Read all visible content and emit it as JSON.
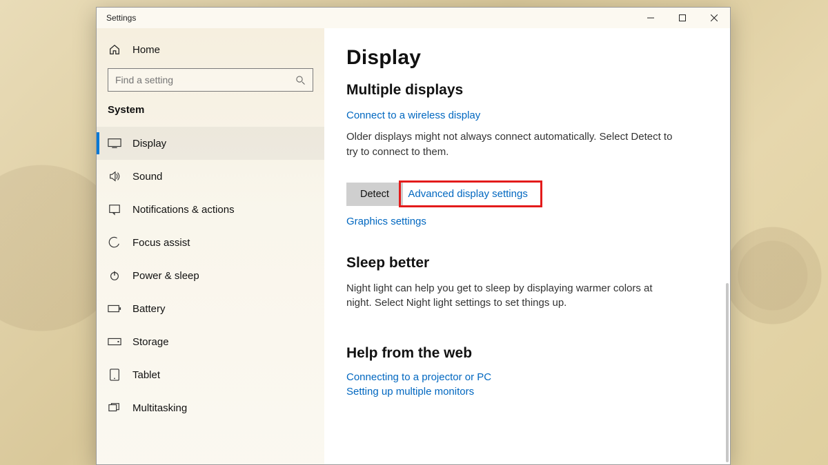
{
  "window": {
    "title": "Settings"
  },
  "sidebar": {
    "home": "Home",
    "search_placeholder": "Find a setting",
    "category": "System",
    "items": [
      {
        "label": "Display",
        "icon": "display-icon",
        "selected": true
      },
      {
        "label": "Sound",
        "icon": "sound-icon"
      },
      {
        "label": "Notifications & actions",
        "icon": "notifications-icon"
      },
      {
        "label": "Focus assist",
        "icon": "focus-assist-icon"
      },
      {
        "label": "Power & sleep",
        "icon": "power-icon"
      },
      {
        "label": "Battery",
        "icon": "battery-icon"
      },
      {
        "label": "Storage",
        "icon": "storage-icon"
      },
      {
        "label": "Tablet",
        "icon": "tablet-icon"
      },
      {
        "label": "Multitasking",
        "icon": "multitasking-icon"
      }
    ]
  },
  "main": {
    "title": "Display",
    "multiple_displays": {
      "heading": "Multiple displays",
      "wireless_link": "Connect to a wireless display",
      "detect_hint": "Older displays might not always connect automatically. Select Detect to try to connect to them.",
      "detect_button": "Detect",
      "advanced_link": "Advanced display settings",
      "graphics_link": "Graphics settings"
    },
    "sleep_better": {
      "heading": "Sleep better",
      "body": "Night light can help you get to sleep by displaying warmer colors at night. Select Night light settings to set things up."
    },
    "help": {
      "heading": "Help from the web",
      "links": [
        "Connecting to a projector or PC",
        "Setting up multiple monitors"
      ]
    }
  }
}
